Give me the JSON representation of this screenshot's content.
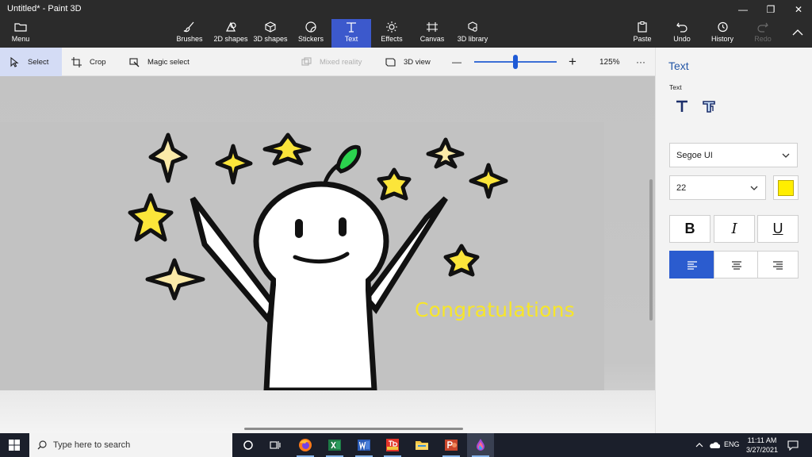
{
  "window": {
    "title": "Untitled* - Paint 3D",
    "minimize": "—",
    "maximize": "❐",
    "close": "✕"
  },
  "ribbon": {
    "menu": "Menu",
    "tools": [
      {
        "id": "brushes",
        "label": "Brushes",
        "icon": "brush-icon"
      },
      {
        "id": "2d-shapes",
        "label": "2D shapes",
        "icon": "2d-shapes-icon"
      },
      {
        "id": "3d-shapes",
        "label": "3D shapes",
        "icon": "cube-icon"
      },
      {
        "id": "stickers",
        "label": "Stickers",
        "icon": "sticker-icon"
      },
      {
        "id": "text",
        "label": "Text",
        "icon": "text-icon",
        "active": true
      },
      {
        "id": "effects",
        "label": "Effects",
        "icon": "sun-icon"
      },
      {
        "id": "canvas",
        "label": "Canvas",
        "icon": "canvas-icon"
      },
      {
        "id": "3d-library",
        "label": "3D library",
        "icon": "library-icon"
      }
    ],
    "paste": "Paste",
    "undo": "Undo",
    "history": "History",
    "redo": "Redo",
    "collapse": "^"
  },
  "toolbar": {
    "select": "Select",
    "crop": "Crop",
    "magic_select": "Magic select",
    "mixed_reality": "Mixed reality",
    "view_3d": "3D view",
    "zoom_minus": "—",
    "zoom_plus": "+",
    "zoom_level": "125%",
    "more": "···",
    "zoom_fraction": 0.5
  },
  "canvas": {
    "text_object": "Congratulations",
    "text_color": "#f7e629"
  },
  "panel": {
    "title": "Text",
    "section": "Text",
    "font_family": "Segoe UI",
    "font_size": "22",
    "text_color": "#ffee00",
    "bold": "B",
    "italic": "I",
    "underline": "U",
    "align": "left"
  },
  "taskbar": {
    "search_placeholder": "Type here to search",
    "apps": [
      "task-view",
      "firefox",
      "excel",
      "word",
      "tp-link",
      "file-explorer",
      "powerpoint",
      "paint-3d"
    ],
    "language": "ENG",
    "time": "11:11 AM",
    "date": "3/27/2021"
  },
  "colors": {
    "accent": "#3c59cc",
    "ribbon_bg": "#2b2b2b",
    "taskbar_bg": "#1b1f2b"
  }
}
